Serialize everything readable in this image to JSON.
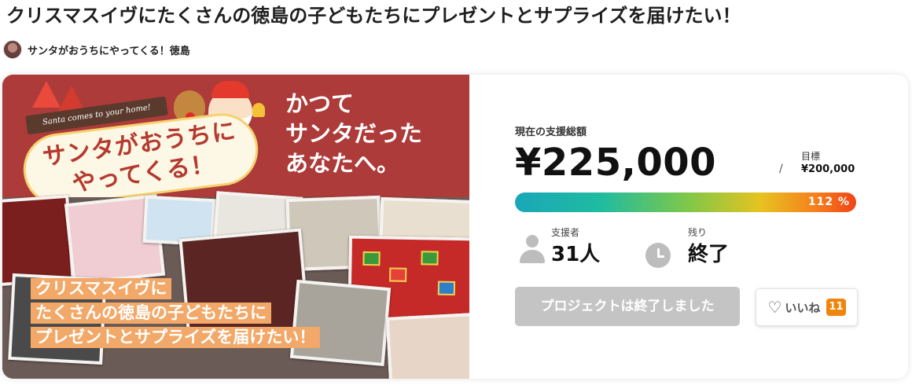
{
  "project": {
    "title": "クリスマスイヴにたくさんの徳島の子どもたちにプレゼントとサプライズを届けたい！",
    "owner_name": "サンタがおうちにやってくる！徳島"
  },
  "hero": {
    "ribbon_text": "Santa comes to your home!",
    "logo_text": "サンタがおうちにやってくる！",
    "message": [
      "かつて",
      "サンタだった",
      "あなたへ。"
    ],
    "caption_lines": [
      "クリスマスイヴに",
      "たくさんの徳島の子どもたちに",
      "プレゼントとサプライズを届けたい！"
    ]
  },
  "funding": {
    "amount_label": "現在の支援総額",
    "amount": "¥225,000",
    "goal_separator": "/",
    "goal_label": "目標",
    "goal_value": "¥200,000",
    "progress_label": "112 %",
    "progress_fraction": 1.12
  },
  "stats": {
    "supporters_label": "支援者",
    "supporters_value": "31人",
    "remaining_label": "残り",
    "remaining_value": "終了"
  },
  "actions": {
    "ended_label": "プロジェクトは終了しました",
    "like_label": "いいね",
    "like_count": "11"
  },
  "colors": {
    "hero_red": "#ac3b39",
    "caption_orange": "#f2a868",
    "like_badge": "#f0850c",
    "disabled_button": "#c4c4c4"
  },
  "icons": [
    "person-icon",
    "clock-icon",
    "heart-icon"
  ]
}
